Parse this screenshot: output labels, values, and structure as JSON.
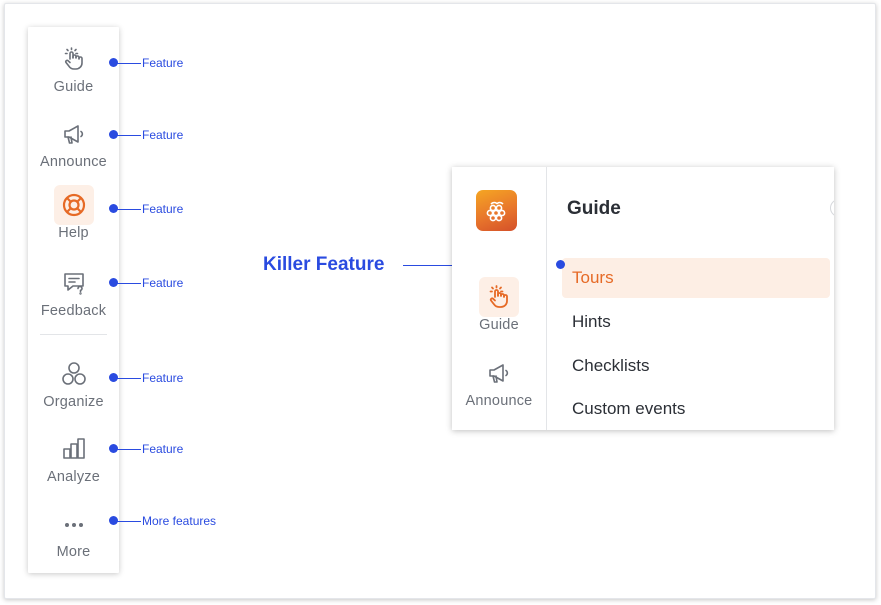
{
  "sidebar": {
    "items": [
      {
        "label": "Guide",
        "icon": "pointer-hand-icon",
        "active": false,
        "callout": "Feature"
      },
      {
        "label": "Announce",
        "icon": "megaphone-icon",
        "active": false,
        "callout": "Feature"
      },
      {
        "label": "Help",
        "icon": "lifebuoy-icon",
        "active": true,
        "callout": "Feature"
      },
      {
        "label": "Feedback",
        "icon": "chat-question-icon",
        "active": false,
        "callout": "Feature"
      },
      {
        "label": "Organize",
        "icon": "circles-icon",
        "active": false,
        "callout": "Feature"
      },
      {
        "label": "Analyze",
        "icon": "bar-chart-icon",
        "active": false,
        "callout": "Feature"
      },
      {
        "label": "More",
        "icon": "more-dots-icon",
        "active": false,
        "callout": "More features"
      }
    ]
  },
  "killer_callout": "Killer Feature",
  "panel": {
    "logo_icon": "grapes-logo-icon",
    "rail": [
      {
        "label": "Guide",
        "icon": "pointer-hand-icon",
        "active": true
      },
      {
        "label": "Announce",
        "icon": "megaphone-icon",
        "active": false
      }
    ],
    "title": "Guide",
    "menu": [
      {
        "label": "Tours",
        "active": true
      },
      {
        "label": "Hints",
        "active": false
      },
      {
        "label": "Checklists",
        "active": false
      },
      {
        "label": "Custom events",
        "active": false
      }
    ]
  },
  "colors": {
    "accent_orange": "#e66a26",
    "active_bg": "#fdefe6",
    "callout_blue": "#2a4be0",
    "nav_gray": "#6b7079"
  }
}
